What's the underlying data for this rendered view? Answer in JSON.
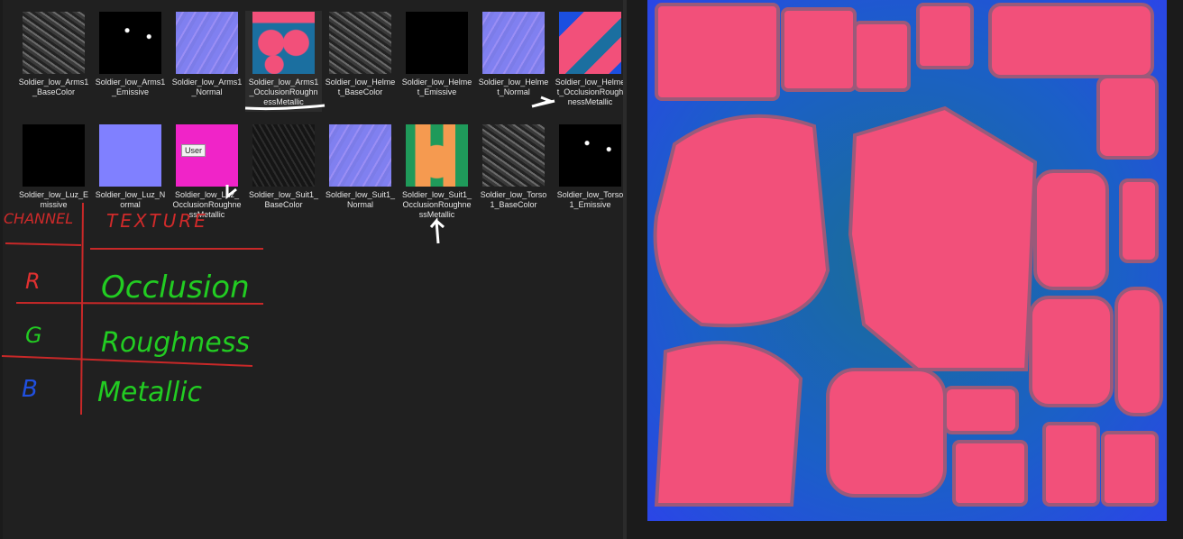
{
  "files": [
    {
      "name": "Soldier_low_Arms1_BaseColor",
      "kind": "basecolor"
    },
    {
      "name": "Soldier_low_Arms1_Emissive",
      "kind": "emissive"
    },
    {
      "name": "Soldier_low_Arms1_Normal",
      "kind": "normal"
    },
    {
      "name": "Soldier_low_Arms1_OcclusionRoughnessMetallic",
      "kind": "orm"
    },
    {
      "name": "Soldier_low_Helmet_BaseColor",
      "kind": "basecolor"
    },
    {
      "name": "Soldier_low_Helmet_Emissive",
      "kind": "black"
    },
    {
      "name": "Soldier_low_Helmet_Normal",
      "kind": "normal"
    },
    {
      "name": "Soldier_low_Helmet_OcclusionRoughnessMetallic",
      "kind": "orm2"
    },
    {
      "name": "Soldier_low_Luz_Emissive",
      "kind": "black"
    },
    {
      "name": "Soldier_low_Luz_Normal",
      "kind": "flatnormal"
    },
    {
      "name": "Soldier_low_Luz_OcclusionRoughnessMetallic",
      "kind": "magenta"
    },
    {
      "name": "Soldier_low_Suit1_BaseColor",
      "kind": "darkbase"
    },
    {
      "name": "Soldier_low_Suit1_Normal",
      "kind": "normal"
    },
    {
      "name": "Soldier_low_Suit1_OcclusionRoughnessMetallic",
      "kind": "orange"
    },
    {
      "name": "Soldier_low_Torso1_BaseColor",
      "kind": "basecolor"
    },
    {
      "name": "Soldier_low_Torso1_Emissive",
      "kind": "emissive"
    }
  ],
  "tooltip": "User",
  "annotation": {
    "header_channel": "CHANNEL",
    "header_texture": "TEXTURE",
    "rows": [
      {
        "channel": "R",
        "texture": "Occlusion",
        "color": "#22cc22",
        "channel_color": "#e03030"
      },
      {
        "channel": "G",
        "texture": "Roughness",
        "color": "#22cc22",
        "channel_color": "#22cc22"
      },
      {
        "channel": "B",
        "texture": "Metallic",
        "color": "#22cc22",
        "channel_color": "#2050e0"
      }
    ]
  },
  "colors": {
    "pink": "#f2507a",
    "blue": "#1f5fe0",
    "teal": "#1b7f9a",
    "red": "#d02a2a"
  }
}
